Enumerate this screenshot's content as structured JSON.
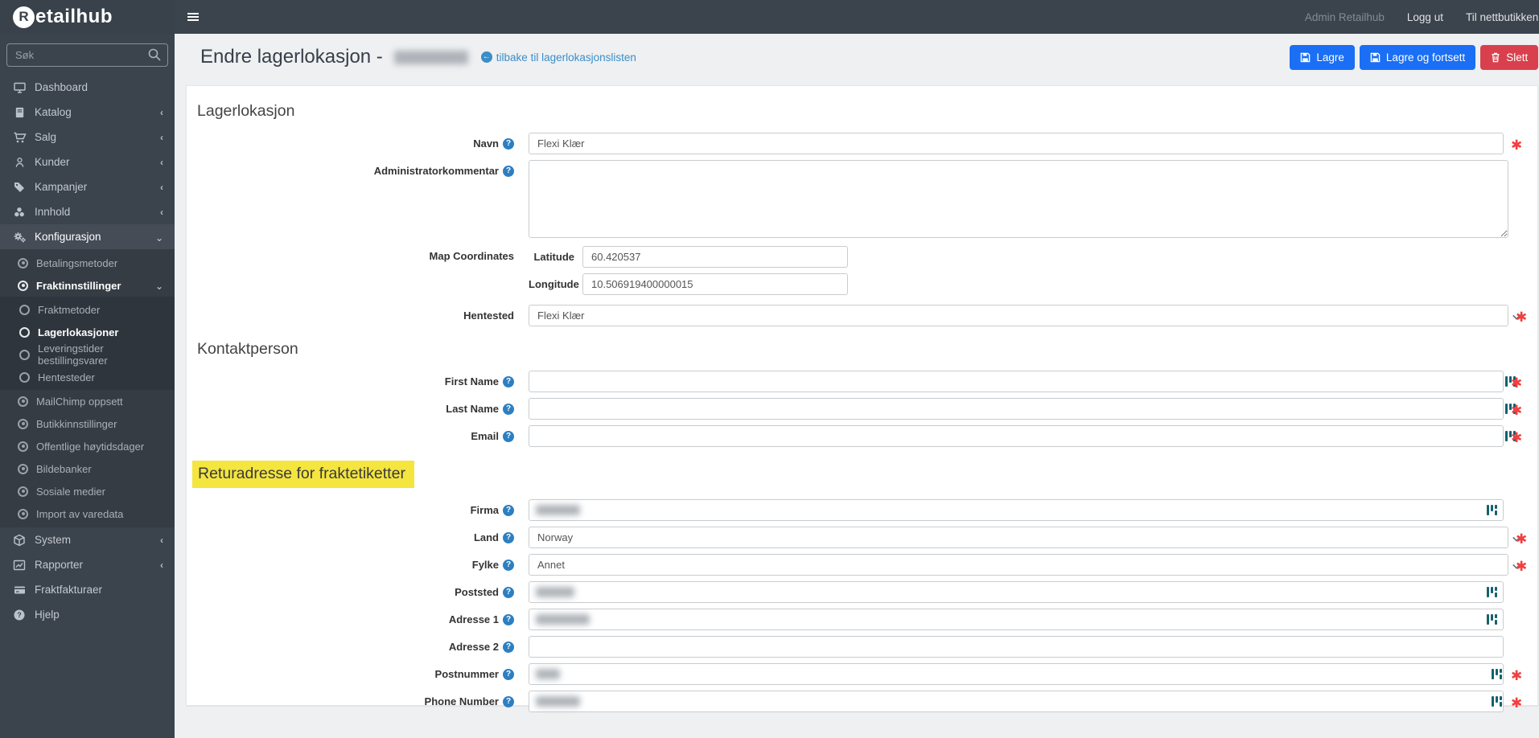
{
  "brand": {
    "logo_initial": "R",
    "logo_rest": "etailhub"
  },
  "topbar": {
    "user": "Admin Retailhub",
    "logout": "Logg ut",
    "to_shop": "Til nettbutikken"
  },
  "sidebar": {
    "search_placeholder": "Søk",
    "main": [
      "Dashboard",
      "Katalog",
      "Salg",
      "Kunder",
      "Kampanjer",
      "Innhold",
      "Konfigurasjon"
    ],
    "config_sub": [
      "Betalingsmetoder",
      "Fraktinnstillinger"
    ],
    "frakt_sub": [
      "Fraktmetoder",
      "Lagerlokasjoner",
      "Leveringstider bestillingsvarer",
      "Hentesteder"
    ],
    "config_sub2": [
      "MailChimp oppsett",
      "Butikkinnstillinger",
      "Offentlige høytidsdager",
      "Bildebanker",
      "Sosiale medier",
      "Import av varedata"
    ],
    "bottom": [
      "System",
      "Rapporter",
      "Fraktfakturaer",
      "Hjelp"
    ]
  },
  "page": {
    "title_prefix": "Endre lagerlokasjon -",
    "back_link": "tilbake til lagerlokasjonslisten",
    "save_label": "Lagre",
    "save_continue_label": "Lagre og fortsett",
    "delete_label": "Slett"
  },
  "form": {
    "heading_lagerlokasjon": "Lagerlokasjon",
    "heading_kontaktperson": "Kontaktperson",
    "heading_retur": "Returadresse for fraktetiketter",
    "navn": {
      "label": "Navn",
      "value": "Flexi Klær"
    },
    "adminkommentar": {
      "label": "Administratorkommentar",
      "value": ""
    },
    "map": {
      "label": "Map Coordinates",
      "lat_label": "Latitude",
      "lat_value": "60.420537",
      "lng_label": "Longitude",
      "lng_value": "10.506919400000015"
    },
    "hentested": {
      "label": "Hentested",
      "value": "Flexi Klær"
    },
    "first_name": {
      "label": "First Name",
      "value": ""
    },
    "last_name": {
      "label": "Last Name",
      "value": ""
    },
    "email": {
      "label": "Email",
      "value": ""
    },
    "firma": {
      "label": "Firma"
    },
    "land": {
      "label": "Land",
      "value": "Norway"
    },
    "fylke": {
      "label": "Fylke",
      "value": "Annet"
    },
    "poststed": {
      "label": "Poststed"
    },
    "adresse1": {
      "label": "Adresse 1"
    },
    "adresse2": {
      "label": "Adresse 2",
      "value": ""
    },
    "postnummer": {
      "label": "Postnummer"
    },
    "phone": {
      "label": "Phone Number"
    }
  },
  "colors": {
    "sidebar_bg": "#3b434c",
    "submenu_bg": "#353c44",
    "submenu2_bg": "#2f353c",
    "content_bg": "#eef0f2",
    "accent_button_blue": "#1a6ff5",
    "danger_red": "#d9404d",
    "link_blue": "#3b8ec8",
    "question_icon_blue": "#2d7fc1",
    "highlight_yellow": "#f4e53f",
    "required_red": "#f23f3f",
    "autofill_icon_teal": "#15616d"
  }
}
